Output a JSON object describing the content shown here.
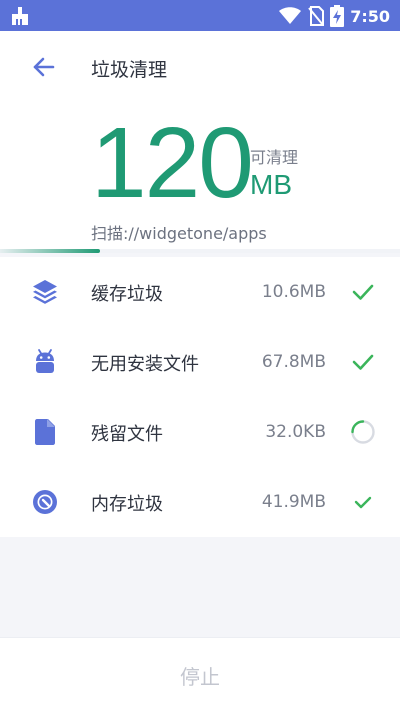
{
  "status_bar": {
    "time": "7:50",
    "icons": [
      "cleaner-icon",
      "wifi-icon",
      "no-sim-icon",
      "battery-charging-icon"
    ]
  },
  "header": {
    "title": "垃圾清理",
    "size_value": "120",
    "size_unit": "MB",
    "cleanable_label": "可清理",
    "scan_path": "扫描://widgetone/apps",
    "scan_progress": 0.25
  },
  "items": [
    {
      "label": "缓存垃圾",
      "size": "10.6MB",
      "icon": "layers-icon",
      "status": "done"
    },
    {
      "label": "无用安装文件",
      "size": "67.8MB",
      "icon": "android-icon",
      "status": "done"
    },
    {
      "label": "残留文件",
      "size": "32.0KB",
      "icon": "file-icon",
      "status": "scanning"
    },
    {
      "label": "内存垃圾",
      "size": "41.9MB",
      "icon": "memory-icon",
      "status": "done"
    }
  ],
  "footer": {
    "stop_label": "停止"
  },
  "colors": {
    "status_bar": "#5b72d8",
    "accent_green": "#1f9a74",
    "icon_blue": "#5b72d8",
    "check_green": "#3bb55b"
  }
}
